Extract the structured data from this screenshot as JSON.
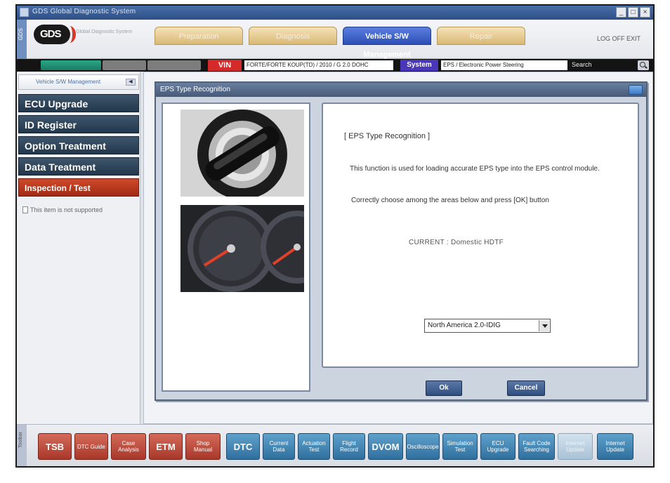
{
  "window": {
    "title": "GDS Global Diagnostic System",
    "buttons": [
      "_",
      "□",
      "×"
    ]
  },
  "header": {
    "side_tag": "GDS",
    "logo_text": "GDS",
    "logo_sub": "Global Diagnostic System",
    "tabs": [
      {
        "label": "Preparation",
        "active": false
      },
      {
        "label": "Diagnosis",
        "active": false
      },
      {
        "label": "Vehicle S/W Management",
        "active": true
      },
      {
        "label": "Repair",
        "active": false
      }
    ],
    "logoff": "LOG OFF EXIT"
  },
  "infobar": {
    "vin_label": "VIN",
    "vin_value": "FORTE/FORTE KOUP(TD) / 2010 / G 2.0 DOHC",
    "system_label": "System",
    "system_value": "EPS / Electronic Power Steering",
    "search_label": "Search"
  },
  "sidebar": {
    "header": "Vehicle S/W Management",
    "items": [
      {
        "label": "ECU Upgrade",
        "style": "dark"
      },
      {
        "label": "ID Register",
        "style": "dark"
      },
      {
        "label": "Option Treatment",
        "style": "dark"
      },
      {
        "label": "Data Treatment",
        "style": "dark"
      },
      {
        "label": "Inspection / Test",
        "style": "red"
      }
    ],
    "not_supported": "This item is not supported"
  },
  "dialog": {
    "title": "EPS Type Recognition",
    "heading": "[ EPS Type Recognition ]",
    "description": "This function is used for loading accurate EPS type into the EPS control module.",
    "instruction": "Correctly choose among the areas below and press [OK] button",
    "current": "CURRENT : Domestic HDTF",
    "select_value": "North America 2.0-IDIG",
    "ok_label": "Ok",
    "cancel_label": "Cancel"
  },
  "bottombar": {
    "side_label": "Toolbar",
    "buttons": [
      {
        "label": "TSB",
        "style": "red",
        "big": true
      },
      {
        "label": "DTC Guide",
        "style": "red",
        "big": false
      },
      {
        "label": "Case Analysis",
        "style": "red",
        "big": false
      },
      {
        "label": "ETM",
        "style": "red",
        "big": true
      },
      {
        "label": "Shop Manual",
        "style": "red",
        "big": false
      },
      {
        "label": "DTC",
        "style": "blue",
        "big": true
      },
      {
        "label": "Current Data",
        "style": "blue",
        "big": false
      },
      {
        "label": "Actuation Test",
        "style": "blue",
        "big": false
      },
      {
        "label": "Flight Record",
        "style": "blue",
        "big": false
      },
      {
        "label": "DVOM",
        "style": "blue",
        "big": true
      },
      {
        "label": "Oscilloscope",
        "style": "blue",
        "big": false
      },
      {
        "label": "Simulation Test",
        "style": "blue",
        "big": false
      },
      {
        "label": "ECU Upgrade",
        "style": "blue",
        "big": false
      },
      {
        "label": "Fault Code Searching",
        "style": "blue",
        "big": false
      },
      {
        "label": "Internet Update",
        "style": "light",
        "big": false
      },
      {
        "label": "Internet Update",
        "style": "blue",
        "big": false
      }
    ]
  },
  "colors": {
    "accent_blue": "#2d4fb6",
    "menu_dark": "#2a3f55",
    "menu_red": "#c0401e",
    "vin_red": "#d42a2a",
    "system_purple": "#4a36b8"
  }
}
